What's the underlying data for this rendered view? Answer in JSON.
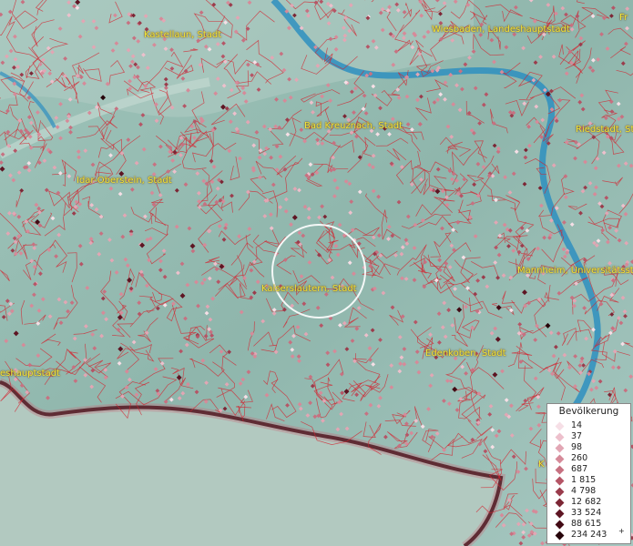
{
  "map": {
    "labels": [
      {
        "text": "Kastellaun, Stadt"
      },
      {
        "text": "Wiesbaden, Landeshauptstadt"
      },
      {
        "text": "Fr"
      },
      {
        "text": "Bad Kreuznach, Stadt"
      },
      {
        "text": "Riedstadt, Stadt"
      },
      {
        "text": "Idar-Oberstein, Stadt"
      },
      {
        "text": "Kaiserslautern, Stadt"
      },
      {
        "text": "Mannheim, Universitätsstadt"
      },
      {
        "text": "Edenkoben, Stadt"
      },
      {
        "text": "eshauptstadt"
      },
      {
        "text": "K"
      }
    ]
  },
  "legend": {
    "title": "Bevölkerung",
    "items": [
      {
        "label": "14",
        "color": "#f6dfe6"
      },
      {
        "label": "37",
        "color": "#edc0cc"
      },
      {
        "label": "98",
        "color": "#e2a6b4"
      },
      {
        "label": "260",
        "color": "#d68a99"
      },
      {
        "label": "687",
        "color": "#c77181"
      },
      {
        "label": "1 815",
        "color": "#b55566"
      },
      {
        "label": "4 798",
        "color": "#9a3c4c"
      },
      {
        "label": "12 682",
        "color": "#7c2635"
      },
      {
        "label": "33 524",
        "color": "#5e1523"
      },
      {
        "label": "88 615",
        "color": "#420a14"
      },
      {
        "label": "234 243",
        "color": "#26040a"
      }
    ],
    "more_symbol": "+"
  }
}
